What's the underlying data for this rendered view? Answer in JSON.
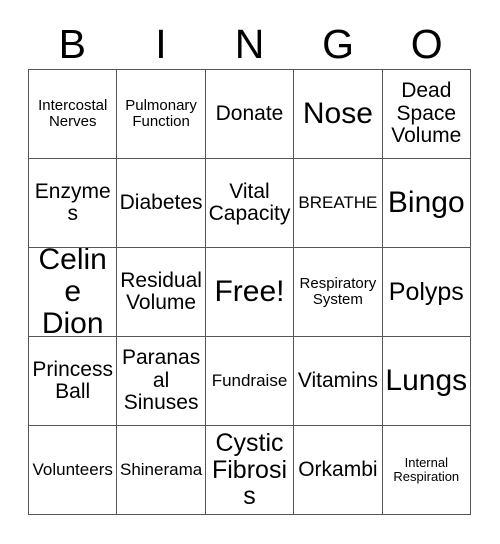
{
  "card": {
    "header_letters": [
      "B",
      "I",
      "N",
      "G",
      "O"
    ],
    "rows": [
      [
        {
          "text": "Intercostal Nerves",
          "size": "sz-s"
        },
        {
          "text": "Pulmonary Function",
          "size": "sz-s"
        },
        {
          "text": "Donate",
          "size": "sz-l"
        },
        {
          "text": "Nose",
          "size": "sz-xxl"
        },
        {
          "text": "Dead Space Volume",
          "size": "sz-l"
        }
      ],
      [
        {
          "text": "Enzymes",
          "size": "sz-l"
        },
        {
          "text": "Diabetes",
          "size": "sz-l"
        },
        {
          "text": "Vital Capacity",
          "size": "sz-l"
        },
        {
          "text": "BREATHE",
          "size": "sz-m"
        },
        {
          "text": "Bingo",
          "size": "sz-xxl"
        }
      ],
      [
        {
          "text": "Celine Dion",
          "size": "sz-xxl"
        },
        {
          "text": "Residual Volume",
          "size": "sz-l"
        },
        {
          "text": "Free!",
          "size": "sz-xxl"
        },
        {
          "text": "Respiratory System",
          "size": "sz-s"
        },
        {
          "text": "Polyps",
          "size": "sz-xl"
        }
      ],
      [
        {
          "text": "Princess Ball",
          "size": "sz-l"
        },
        {
          "text": "Paranasal Sinuses",
          "size": "sz-l"
        },
        {
          "text": "Fundraise",
          "size": "sz-m"
        },
        {
          "text": "Vitamins",
          "size": "sz-l"
        },
        {
          "text": "Lungs",
          "size": "sz-xxl"
        }
      ],
      [
        {
          "text": "Volunteers",
          "size": "sz-m"
        },
        {
          "text": "Shinerama",
          "size": "sz-m"
        },
        {
          "text": "Cystic Fibrosis",
          "size": "sz-xl"
        },
        {
          "text": "Orkambi",
          "size": "sz-l"
        },
        {
          "text": "Internal Respiration",
          "size": "sz-xs"
        }
      ]
    ]
  },
  "colors": {
    "border": "#555555",
    "text": "#000000",
    "background": "#ffffff"
  }
}
